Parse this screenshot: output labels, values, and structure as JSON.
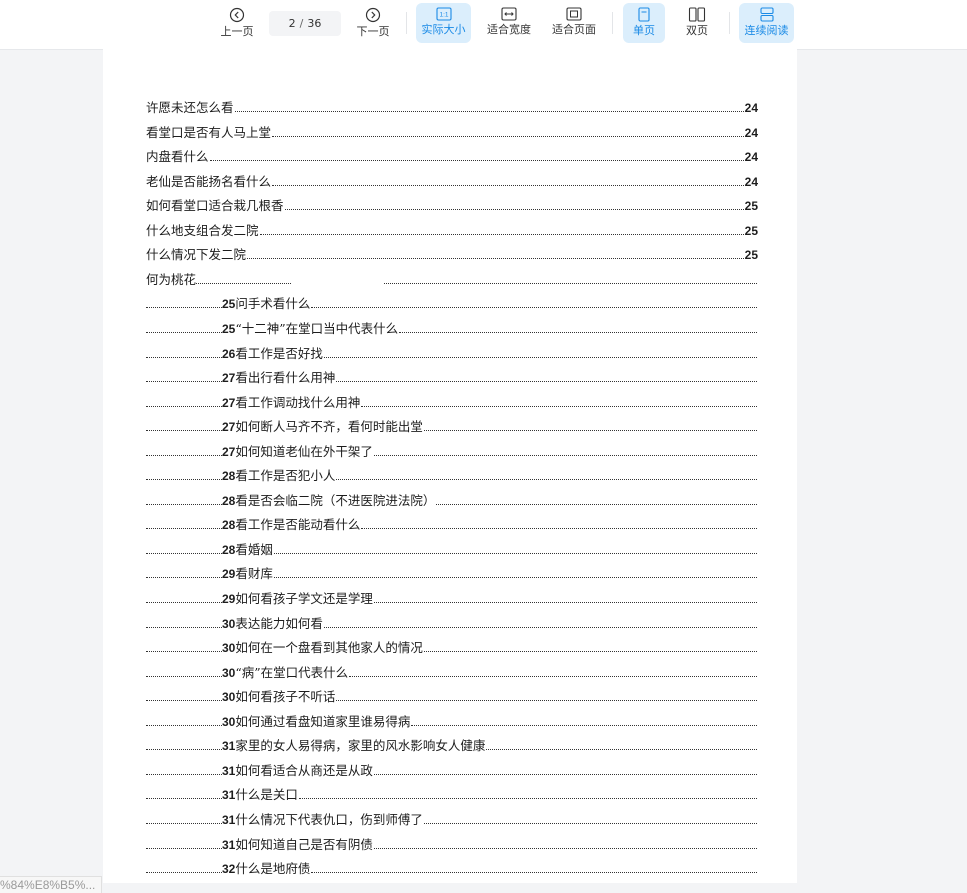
{
  "toolbar": {
    "prev_label": "上一页",
    "next_label": "下一页",
    "current_page": "2",
    "total_pages": "36",
    "actual_size_label": "实际大小",
    "fit_width_label": "适合宽度",
    "fit_page_label": "适合页面",
    "single_page_label": "单页",
    "double_page_label": "双页",
    "continuous_label": "连续阅读",
    "actual_size_icon_text": "1:1",
    "accent_color": "#1a8ae6",
    "active_bg": "#dbeefc"
  },
  "toc": {
    "entries": [
      {
        "title": "许愿未还怎么看",
        "page": "24"
      },
      {
        "title": "看堂口是否有人马上堂",
        "page": "24"
      },
      {
        "title": "内盘看什么",
        "page": "24"
      },
      {
        "title": "老仙是否能扬名看什么",
        "page": "24"
      },
      {
        "title": "如何看堂口适合栽几根香",
        "page": "25"
      },
      {
        "title": "什么地支组合发二院",
        "page": "25"
      },
      {
        "title": "什么情况下发二院",
        "page": "25"
      },
      {
        "title": "何为桃花",
        "page": ""
      }
    ],
    "shifted": [
      {
        "page": "25",
        "title": "问手术看什么"
      },
      {
        "page": "25",
        "title": "“十二神”在堂口当中代表什么"
      },
      {
        "page": "26",
        "title": "看工作是否好找"
      },
      {
        "page": "27",
        "title": "看出行看什么用神"
      },
      {
        "page": "27",
        "title": "看工作调动找什么用神"
      },
      {
        "page": "27",
        "title": "如何断人马齐不齐，看何时能出堂"
      },
      {
        "page": "27",
        "title": "如何知道老仙在外干架了"
      },
      {
        "page": "28",
        "title": "看工作是否犯小人"
      },
      {
        "page": "28",
        "title": "看是否会临二院（不进医院进法院）"
      },
      {
        "page": "28",
        "title": "看工作是否能动看什么"
      },
      {
        "page": "28",
        "title": "看婚姻"
      },
      {
        "page": "29",
        "title": "看财库"
      },
      {
        "page": "29",
        "title": "如何看孩子学文还是学理"
      },
      {
        "page": "30",
        "title": "表达能力如何看"
      },
      {
        "page": "30",
        "title": "如何在一个盘看到其他家人的情况"
      },
      {
        "page": "30",
        "title": "“病”在堂口代表什么"
      },
      {
        "page": "30",
        "title": "如何看孩子不听话"
      },
      {
        "page": "30",
        "title": "如何通过看盘知道家里谁易得病"
      },
      {
        "page": "31",
        "title": "家里的女人易得病，家里的风水影响女人健康"
      },
      {
        "page": "31",
        "title": "如何看适合从商还是从政"
      },
      {
        "page": "31",
        "title": "什么是关口"
      },
      {
        "page": "31",
        "title": "什么情况下代表仇口，伤到师傅了"
      },
      {
        "page": "31",
        "title": "如何知道自己是否有阴债"
      },
      {
        "page": "32",
        "title": "什么是地府债"
      }
    ]
  },
  "status_url": "%84%E8%B5%..."
}
